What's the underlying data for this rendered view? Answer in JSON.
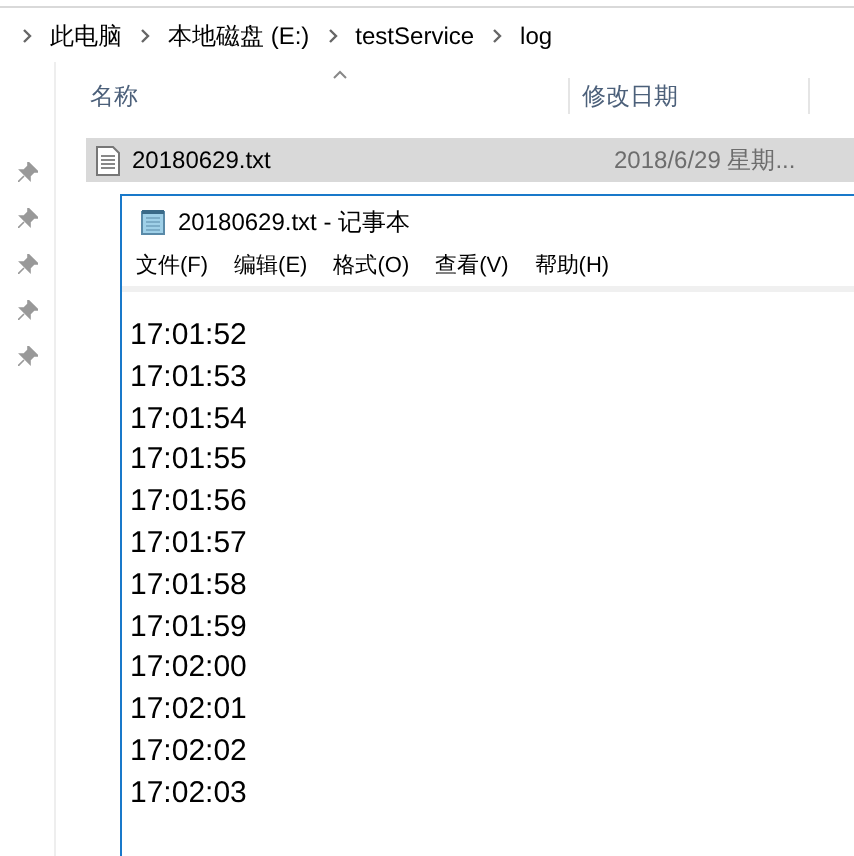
{
  "breadcrumb": [
    "此电脑",
    "本地磁盘 (E:)",
    "testService",
    "log"
  ],
  "columns": [
    "名称",
    "修改日期"
  ],
  "files": [
    {
      "name": "20180629.txt",
      "modified": "2018/6/29 星期...",
      "selected": true
    }
  ],
  "notepad": {
    "title": "20180629.txt - 记事本",
    "menu": [
      "文件(F)",
      "编辑(E)",
      "格式(O)",
      "查看(V)",
      "帮助(H)"
    ],
    "lines": [
      "17:01:52",
      "17:01:53",
      "17:01:54",
      "17:01:55",
      "17:01:56",
      "17:01:57",
      "17:01:58",
      "17:01:59",
      "17:02:00",
      "17:02:01",
      "17:02:02",
      "17:02:03"
    ]
  }
}
